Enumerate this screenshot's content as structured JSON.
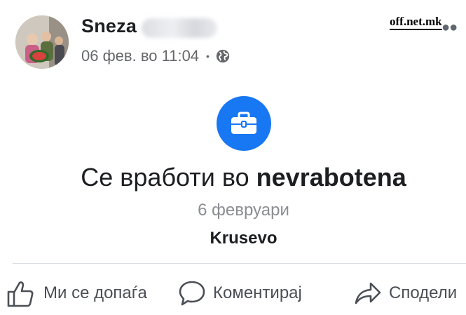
{
  "post": {
    "author_name": "Sneza",
    "timestamp": "06 фев. во 11:04",
    "separator": "•",
    "privacy_icon": "globe-icon",
    "more_icon": "ellipsis-icon"
  },
  "watermark": "off.net.mk",
  "life_event": {
    "icon": "briefcase-icon",
    "icon_bg": "#1877f2",
    "headline_prefix": "Се вработи во",
    "company": "nevrabotena",
    "date": "6 февруари",
    "location": "Krusevo"
  },
  "actions": {
    "like": "Ми се допаѓа",
    "comment": "Коментирај",
    "share": "Сподели"
  }
}
